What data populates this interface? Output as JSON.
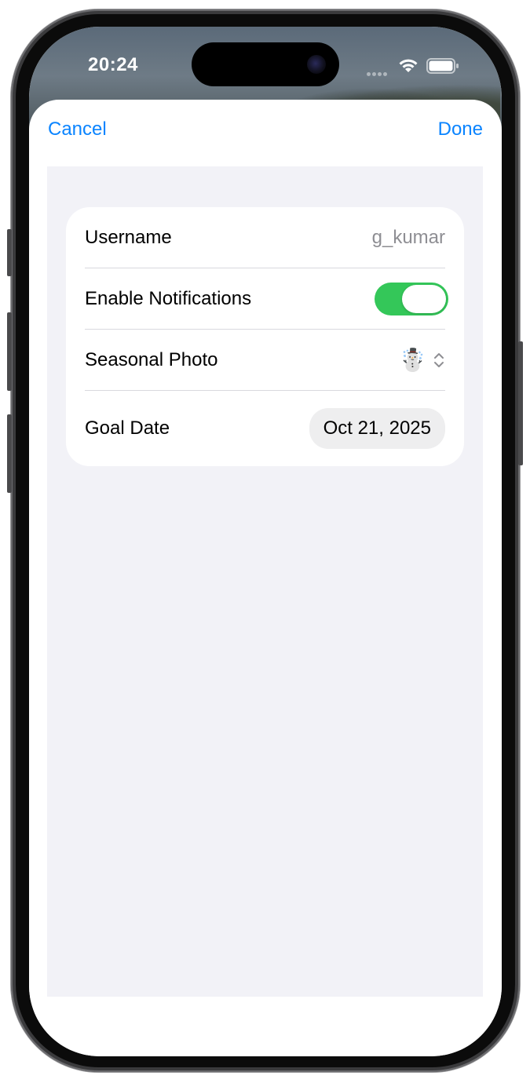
{
  "status_bar": {
    "time": "20:24",
    "icons": [
      "cellular-icon",
      "wifi-icon",
      "battery-icon"
    ]
  },
  "nav": {
    "cancel_label": "Cancel",
    "done_label": "Done"
  },
  "form": {
    "rows": [
      {
        "label": "Username",
        "value": "g_kumar"
      },
      {
        "label": "Enable Notifications",
        "toggle_on": true
      },
      {
        "label": "Seasonal Photo",
        "value": "☃️"
      },
      {
        "label": "Goal Date",
        "value": "Oct 21, 2025"
      }
    ]
  },
  "colors": {
    "accent": "#0a84ff",
    "toggle_on": "#34c759",
    "grouped_bg": "#f2f2f7",
    "secondary_text": "#8e8e93"
  }
}
